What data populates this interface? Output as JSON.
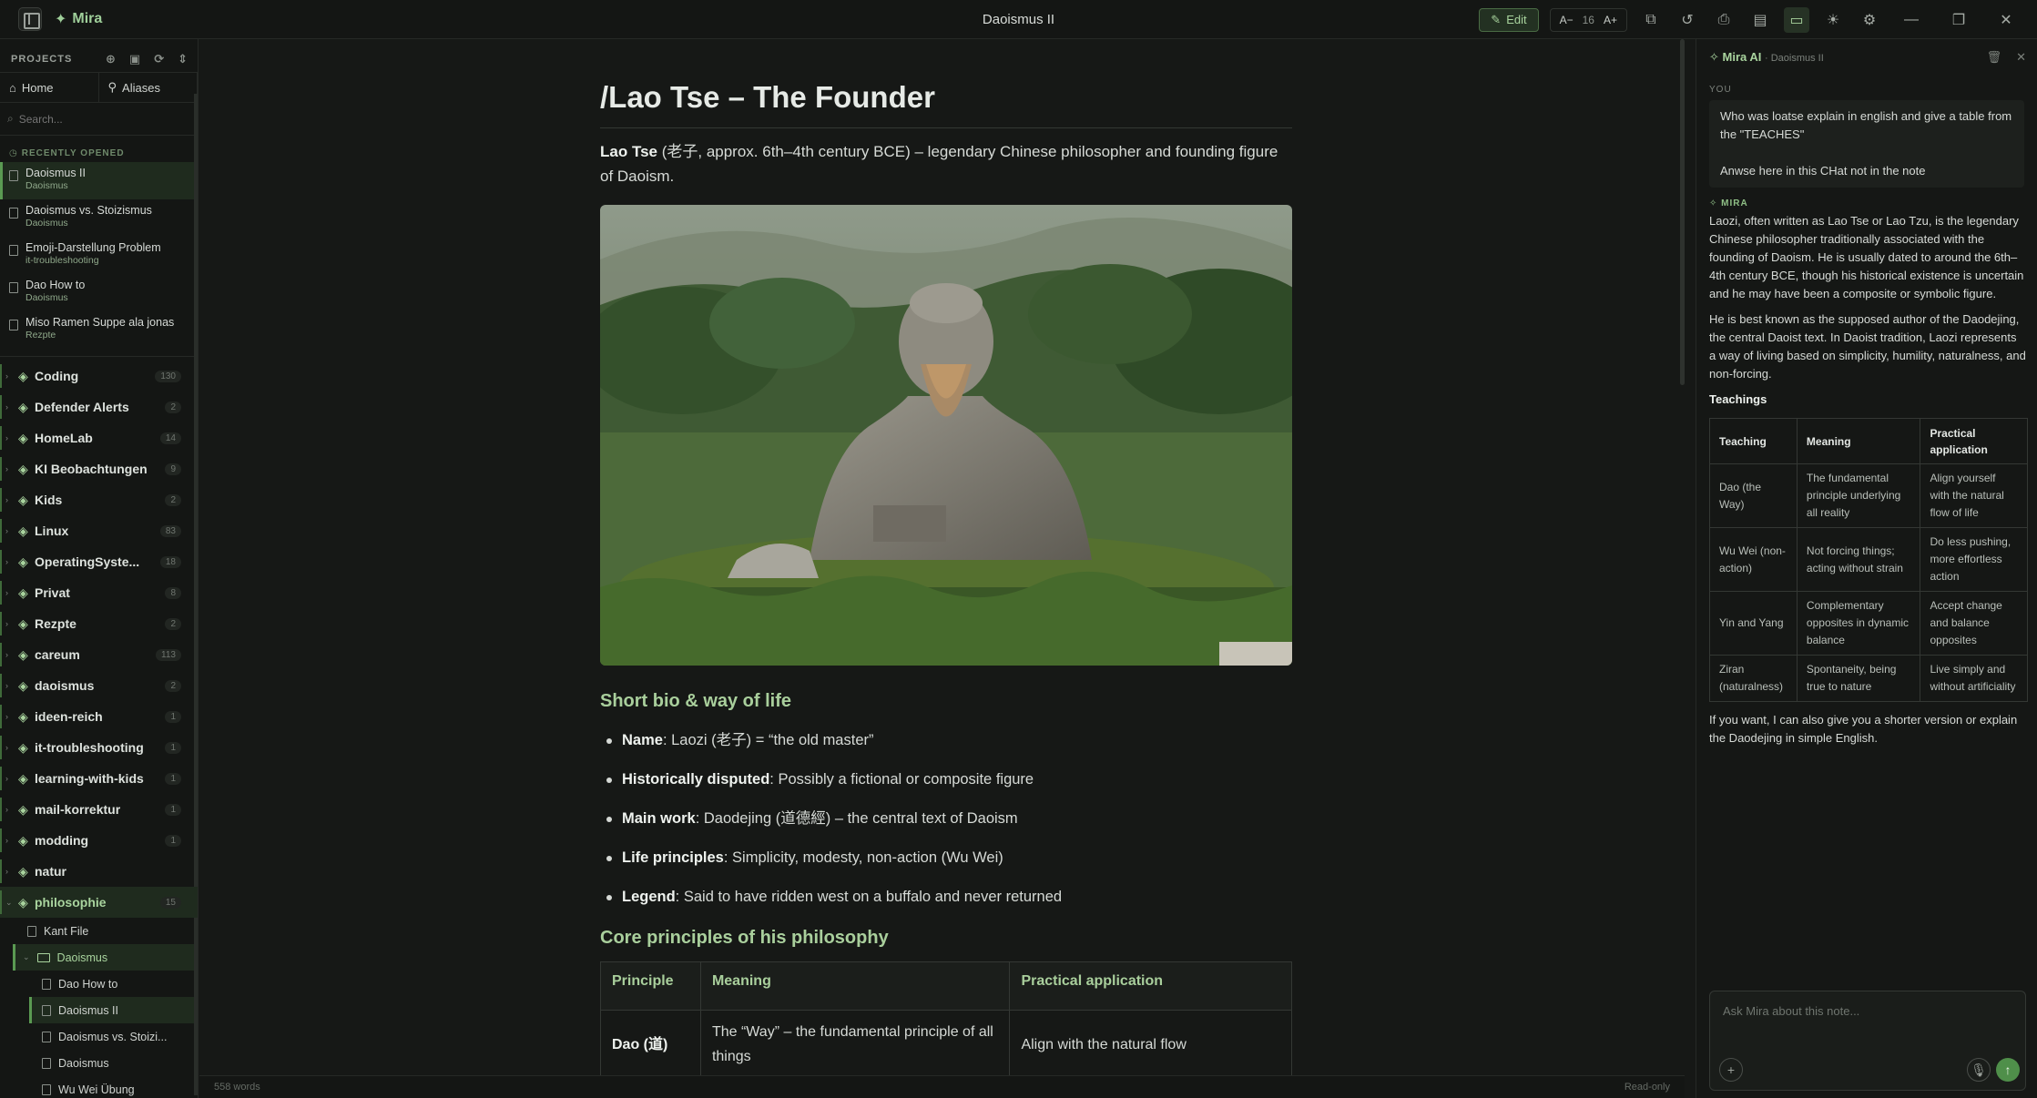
{
  "titlebar": {
    "brand": "Mira",
    "document_title": "Daoismus II",
    "edit_label": "Edit",
    "font_decrease": "A−",
    "font_size": "16",
    "font_increase": "A+"
  },
  "sidebar": {
    "projects_label": "PROJECTS",
    "home_label": "Home",
    "aliases_label": "Aliases",
    "search_placeholder": "Search...",
    "recent_label": "RECENTLY OPENED",
    "recent": [
      {
        "title": "Daoismus II",
        "sub": "Daoismus"
      },
      {
        "title": "Daoismus vs. Stoizismus",
        "sub": "Daoismus"
      },
      {
        "title": "Emoji-Darstellung Problem",
        "sub": "it-troubleshooting"
      },
      {
        "title": "Dao How to",
        "sub": "Daoismus"
      },
      {
        "title": "Miso Ramen Suppe ala jonas",
        "sub": "Rezpte"
      }
    ],
    "projects": [
      {
        "name": "Coding",
        "count": "130"
      },
      {
        "name": "Defender Alerts",
        "count": "2"
      },
      {
        "name": "HomeLab",
        "count": "14"
      },
      {
        "name": "KI Beobachtungen",
        "count": "9"
      },
      {
        "name": "Kids",
        "count": "2"
      },
      {
        "name": "Linux",
        "count": "83"
      },
      {
        "name": "OperatingSyste...",
        "count": "18"
      },
      {
        "name": "Privat",
        "count": "8"
      },
      {
        "name": "Rezpte",
        "count": "2"
      },
      {
        "name": "careum",
        "count": "113"
      },
      {
        "name": "daoismus",
        "count": "2"
      },
      {
        "name": "ideen-reich",
        "count": "1"
      },
      {
        "name": "it-troubleshooting",
        "count": "1"
      },
      {
        "name": "learning-with-kids",
        "count": "1"
      },
      {
        "name": "mail-korrektur",
        "count": "1"
      },
      {
        "name": "modding",
        "count": "1"
      },
      {
        "name": "natur",
        "count": ""
      },
      {
        "name": "philosophie",
        "count": "15"
      }
    ],
    "tree": {
      "kant": "Kant File",
      "folder": "Daoismus",
      "children": [
        "Dao How to",
        "Daoismus II",
        "Daoismus vs. Stoizi...",
        "Daoismus",
        "Wu Wei Übung"
      ]
    }
  },
  "document": {
    "title": "/Lao Tse – The Founder",
    "intro_bold": "Lao Tse",
    "intro_rest": " (老子, approx. 6th–4th century BCE) – legendary Chinese philosopher and founding figure of Daoism.",
    "section1": "Short bio & way of life",
    "bullets": [
      {
        "k": "Name",
        "v": ": Laozi (老子) = “the old master”"
      },
      {
        "k": "Historically disputed",
        "v": ": Possibly a fictional or composite figure"
      },
      {
        "k": "Main work",
        "v": ": Daodejing (道德經) – the central text of Daoism"
      },
      {
        "k": "Life principles",
        "v": ": Simplicity, modesty, non-action (Wu Wei)"
      },
      {
        "k": "Legend",
        "v": ": Said to have ridden west on a buffalo and never returned"
      }
    ],
    "section2": "Core principles of his philosophy",
    "table_headers": [
      "Principle",
      "Meaning",
      "Practical application"
    ],
    "table_rows": [
      [
        "Dao (道)",
        "The “Way” – the fundamental principle of all things",
        "Align with the natural flow"
      ]
    ]
  },
  "statusbar": {
    "words": "558 words",
    "mode": "Read-only"
  },
  "ai": {
    "title": "Mira AI",
    "context": "· Daoismus II",
    "you_label": "YOU",
    "user_message": [
      "Who was loatse explain in english and give a table from the \"TEACHES\"",
      "Anwse here in this CHat not in the note"
    ],
    "mira_label": "MIRA",
    "paragraphs": [
      "Laozi, often written as Lao Tse or Lao Tzu, is the legendary Chinese philosopher traditionally associated with the founding of Daoism. He is usually dated to around the 6th–4th century BCE, though his historical existence is uncertain and he may have been a composite or symbolic figure.",
      "He is best known as the supposed author of the Daodejing, the central Daoist text. In Daoist tradition, Laozi represents a way of living based on simplicity, humility, naturalness, and non-forcing."
    ],
    "teachings_heading": "Teachings",
    "table_headers": [
      "Teaching",
      "Meaning",
      "Practical application"
    ],
    "table_rows": [
      [
        "Dao (the Way)",
        "The fundamental principle underlying all reality",
        "Align yourself with the natural flow of life"
      ],
      [
        "Wu Wei (non-action)",
        "Not forcing things; acting without strain",
        "Do less pushing, more effortless action"
      ],
      [
        "Yin and Yang",
        "Complementary opposites in dynamic balance",
        "Accept change and balance opposites"
      ],
      [
        "Ziran (naturalness)",
        "Spontaneity, being true to nature",
        "Live simply and without artificiality"
      ]
    ],
    "afterword": "If you want, I can also give you a shorter version or explain the Daodejing in simple English.",
    "input_placeholder": "Ask Mira about this note..."
  }
}
